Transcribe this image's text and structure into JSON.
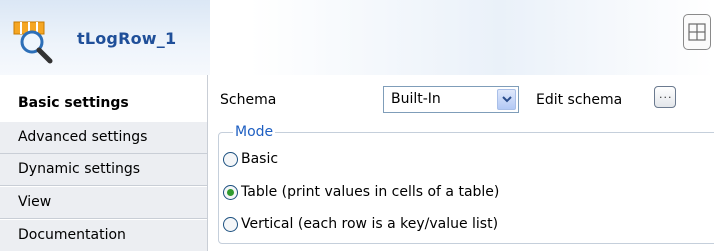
{
  "header": {
    "component_name": "tLogRow_1",
    "component_icon": "log-row-magnifier-icon",
    "view_toggle_icon": "layout-grid-icon"
  },
  "tabs": [
    {
      "label": "Basic settings",
      "active": true
    },
    {
      "label": "Advanced settings",
      "active": false
    },
    {
      "label": "Dynamic settings",
      "active": false
    },
    {
      "label": "View",
      "active": false
    },
    {
      "label": "Documentation",
      "active": false
    }
  ],
  "settings": {
    "schema_label": "Schema",
    "schema_value": "Built-In",
    "edit_schema_label": "Edit schema",
    "edit_schema_button": "...",
    "mode": {
      "legend": "Mode",
      "options": [
        {
          "label": "Basic",
          "checked": false
        },
        {
          "label": "Table (print values in cells of a table)",
          "checked": true
        },
        {
          "label": "Vertical (each row is a key/value list)",
          "checked": false
        }
      ]
    }
  },
  "colors": {
    "title": "#1f4f99",
    "legend": "#1e5fc2",
    "radio_checked": "#2f9a2f",
    "tab_background": "#eceef2"
  }
}
